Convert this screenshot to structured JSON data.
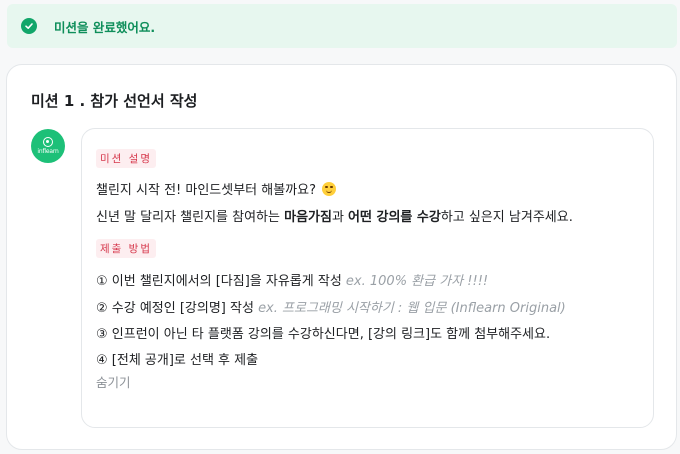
{
  "toast": {
    "message": "미션을 완료했어요."
  },
  "mission": {
    "title": "미션 1 . 참가 선언서 작성",
    "avatar_text": "inflearn",
    "desc_tag": "미션 설명",
    "desc_line1": "챌린지 시작 전! 마인드셋부터 해볼까요?",
    "desc_line2_a": "신년 말 달리자 챌린지를 참여하는 ",
    "desc_line2_b": "마음가짐",
    "desc_line2_c": "과 ",
    "desc_line2_d": "어떤 강의를 수강",
    "desc_line2_e": "하고 싶은지 남겨주세요.",
    "method_tag": "제출 방법",
    "steps": [
      {
        "text": "① 이번 챌린지에서의 [다짐]을 자유롭게 작성 ",
        "example": "ex. 100% 환급 가자 !!!!"
      },
      {
        "text": "② 수강 예정인 [강의명] 작성 ",
        "example": "ex. 프로그래밍 시작하기 : 웹 입문 (Inflearn Original)"
      },
      {
        "text": "③ 인프런이 아닌 타 플랫폼 강의를 수강하신다면, [강의 링크]도 함께 첨부해주세요.",
        "example": ""
      },
      {
        "text": "④ [전체 공개]로 선택 후 제출",
        "example": ""
      }
    ],
    "hide_label": "숨기기"
  },
  "colors": {
    "brand": "#1dc078",
    "toast_bg": "#e7f7ef",
    "tag_bg": "#fdeef0",
    "tag_text": "#d6384c"
  },
  "icons": {
    "toast": "check-circle-icon",
    "emoji": "grinning-face-emoji",
    "logo": "inflearn-logo"
  }
}
